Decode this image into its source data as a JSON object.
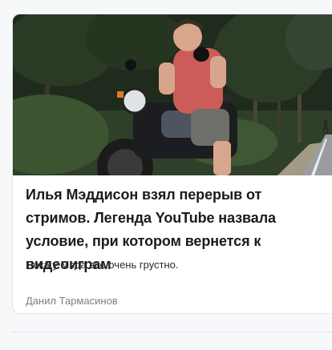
{
  "article": {
    "title": "Илья Мэддисон взял перерыв от стримов. Легенда YouTube назвала условие, при котором вернется к видеоиграм",
    "lead": "Пока у Мэда всё очень грустно.",
    "author": "Данил Тармасинов"
  }
}
